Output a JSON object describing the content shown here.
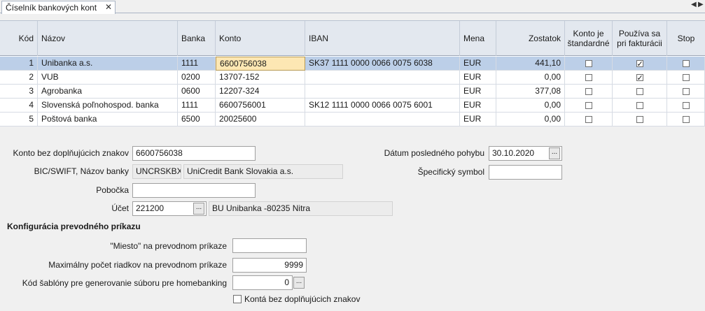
{
  "tab": {
    "title": "Číselník bankových kont",
    "close": "✕",
    "prev": "◀",
    "next": "▶"
  },
  "grid": {
    "headers": {
      "kod": "Kód",
      "nazov": "Názov",
      "banka": "Banka",
      "konto": "Konto",
      "iban": "IBAN",
      "mena": "Mena",
      "zostatok": "Zostatok",
      "standard_1": "Konto je",
      "standard_2": "štandardné",
      "fakt_1": "Používa sa",
      "fakt_2": "pri fakturácii",
      "stop": "Stop"
    },
    "rows": [
      {
        "kod": "1",
        "nazov": "Unibanka a.s.",
        "banka": "1111",
        "konto": "6600756038",
        "iban": "SK37 1111 0000 0066 0075 6038",
        "mena": "EUR",
        "zostatok": "441,10",
        "standard": false,
        "fakt": true,
        "stop": false
      },
      {
        "kod": "2",
        "nazov": "VUB",
        "banka": "0200",
        "konto": "13707-152",
        "iban": "",
        "mena": "EUR",
        "zostatok": "0,00",
        "standard": false,
        "fakt": true,
        "stop": false
      },
      {
        "kod": "3",
        "nazov": "Agrobanka",
        "banka": "0600",
        "konto": "12207-324",
        "iban": "",
        "mena": "EUR",
        "zostatok": "377,08",
        "standard": false,
        "fakt": false,
        "stop": false
      },
      {
        "kod": "4",
        "nazov": "Slovenská poľnohospod. banka",
        "banka": "1111",
        "konto": "6600756001",
        "iban": "SK12 1111 0000 0066 0075 6001",
        "mena": "EUR",
        "zostatok": "0,00",
        "standard": false,
        "fakt": false,
        "stop": false
      },
      {
        "kod": "5",
        "nazov": "Poštová banka",
        "banka": "6500",
        "konto": "20025600",
        "iban": "",
        "mena": "EUR",
        "zostatok": "0,00",
        "standard": false,
        "fakt": false,
        "stop": false
      }
    ]
  },
  "form": {
    "konto_label": "Konto bez doplňujúcich znakov",
    "konto_value": "6600756038",
    "bic_label": "BIC/SWIFT, Názov banky",
    "bic_value": "UNCRSKBX",
    "bank_name": "UniCredit Bank Slovakia a.s.",
    "pobocka_label": "Pobočka",
    "pobocka_value": "",
    "ucet_label": "Účet",
    "ucet_value": "221200",
    "ucet_desc": "BU Unibanka -80235 Nitra",
    "datum_label": "Dátum posledného pohybu",
    "datum_value": "30.10.2020",
    "symbol_label": "Špecifický symbol",
    "symbol_value": "",
    "browse": "...",
    "section_title": "Konfigurácia prevodného príkazu",
    "miesto_label": "\"Miesto\" na prevodnom príkaze",
    "miesto_value": "",
    "max_label": "Maximálny počet riadkov na prevodnom príkaze",
    "max_value": "9999",
    "sablona_label": "Kód šablóny pre generovanie súboru pre homebanking",
    "sablona_value": "0",
    "konta_check_label": "Kontá bez doplňujúcich znakov",
    "konta_check": false
  }
}
